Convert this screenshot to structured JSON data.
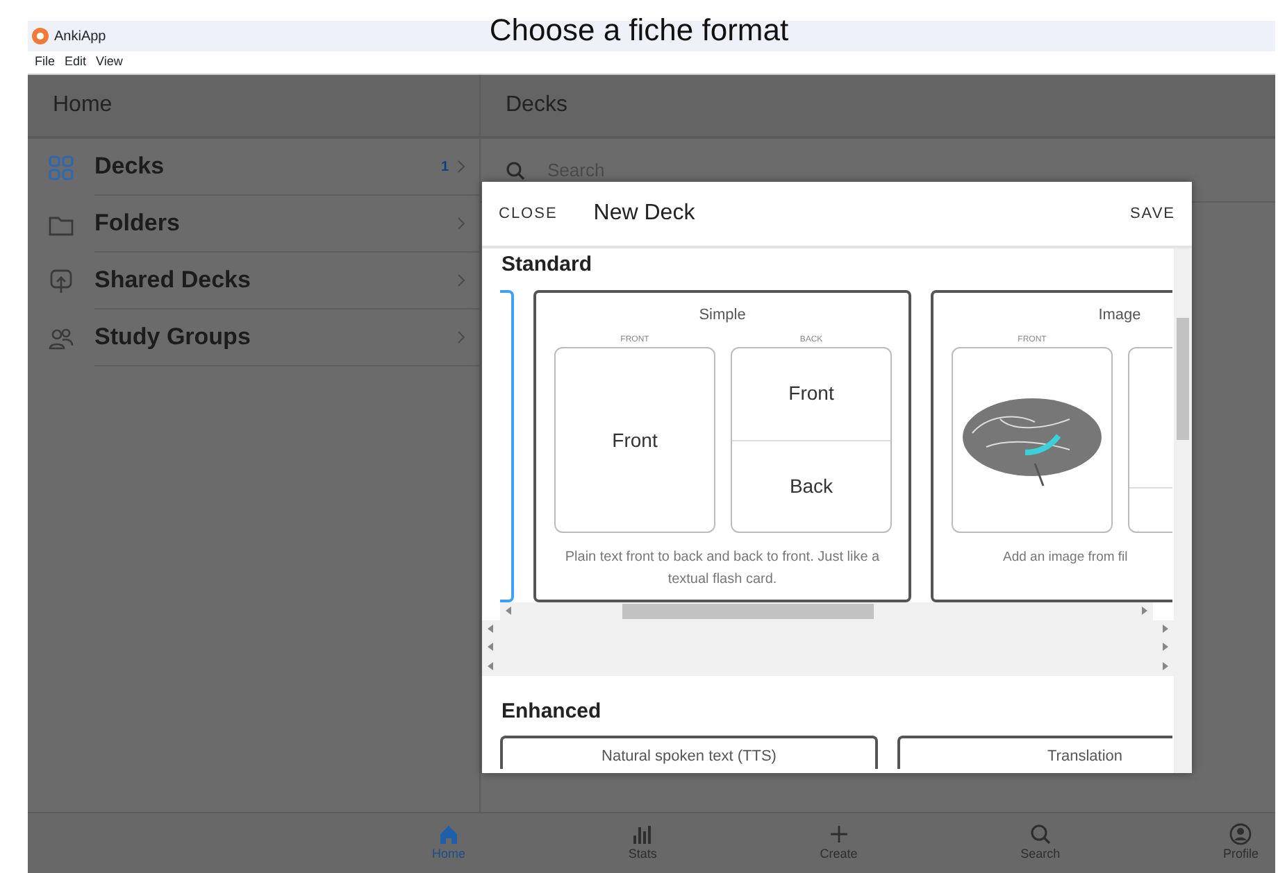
{
  "caption": "Choose a fiche format",
  "window": {
    "title": "AnkiApp",
    "menu": [
      "File",
      "Edit",
      "View"
    ]
  },
  "sidebar": {
    "title": "Home",
    "items": [
      {
        "label": "Decks",
        "count": "1",
        "selected": true
      },
      {
        "label": "Folders",
        "selected": false
      },
      {
        "label": "Shared Decks",
        "selected": false
      },
      {
        "label": "Study Groups",
        "selected": false
      }
    ]
  },
  "main": {
    "title": "Decks",
    "search": {
      "placeholder": "Search"
    }
  },
  "dialog": {
    "close": "CLOSE",
    "title": "New Deck",
    "save": "SAVE",
    "sections": [
      {
        "title": "Standard",
        "formats": [
          {
            "kind": "cut",
            "selected": true
          },
          {
            "kind": "text",
            "selected": false,
            "name": "Simple",
            "faces": [
              {
                "label": "FRONT",
                "lines": [
                  "Front"
                ]
              },
              {
                "label": "BACK",
                "lines": [
                  "Front",
                  "Back"
                ]
              }
            ],
            "description": "Plain text front to back and back to front. Just like a textual flash card."
          },
          {
            "kind": "image",
            "selected": false,
            "name": "Image",
            "faces": [
              {
                "label": "FRONT",
                "kind": "image"
              },
              {
                "kind": "split"
              }
            ],
            "description": "Add an image from fil"
          }
        ]
      },
      {
        "title": "Enhanced",
        "formats": [
          {
            "kind": "text",
            "selected": false,
            "name": "Natural spoken text (TTS)"
          },
          {
            "kind": "text",
            "selected": false,
            "name": "Translation"
          }
        ]
      }
    ]
  },
  "tabs": [
    {
      "label": "Home",
      "selected": true
    },
    {
      "label": "Stats",
      "selected": false
    },
    {
      "label": "Create",
      "selected": false
    },
    {
      "label": "Search",
      "selected": false
    },
    {
      "label": "Profile",
      "selected": false
    }
  ]
}
